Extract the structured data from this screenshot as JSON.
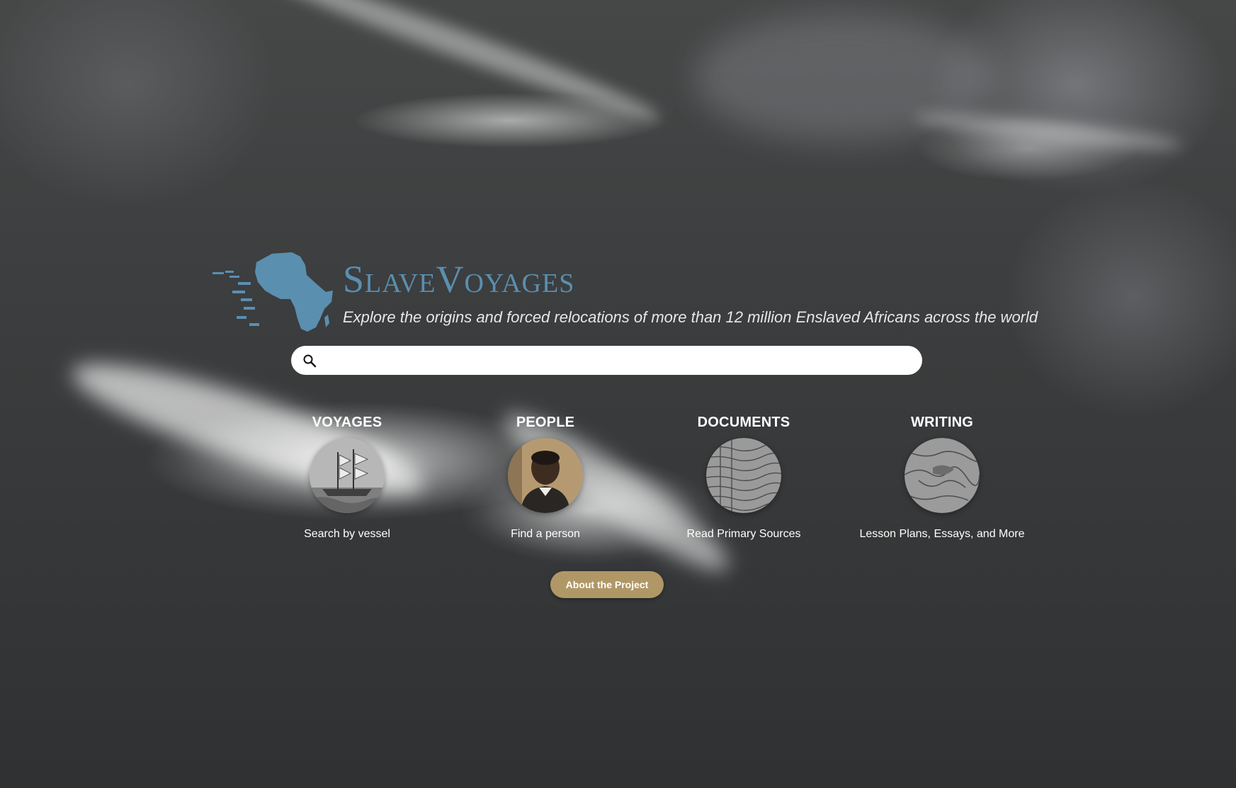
{
  "brand": {
    "title": "SlaveVoyages",
    "tagline": "Explore the origins and forced relocations of more than 12 million Enslaved Africans across the world",
    "logo_icon": "africa-map-icon",
    "accent_color": "#5a8fb0"
  },
  "search": {
    "icon": "search-icon",
    "placeholder": "",
    "value": ""
  },
  "categories": [
    {
      "title": "VOYAGES",
      "subtitle": "Search by vessel",
      "image": "ship-engraving"
    },
    {
      "title": "PEOPLE",
      "subtitle": "Find a person",
      "image": "portrait-photo"
    },
    {
      "title": "DOCUMENTS",
      "subtitle": "Read Primary Sources",
      "image": "handwritten-ledger"
    },
    {
      "title": "WRITING",
      "subtitle": "Lesson Plans, Essays, and More",
      "image": "historic-map"
    }
  ],
  "about_button": {
    "label": "About the Project",
    "color": "#b09766"
  }
}
